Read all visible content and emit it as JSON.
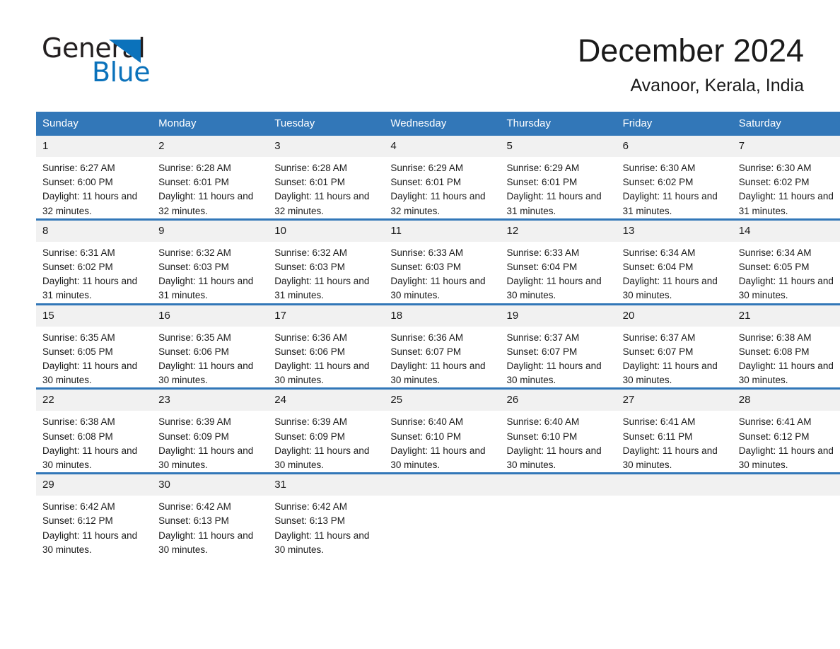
{
  "brand": {
    "name_part1": "General",
    "name_part2": "Blue",
    "accent_color": "#0b72bb",
    "header_color": "#3277b8"
  },
  "header": {
    "title": "December 2024",
    "location": "Avanoor, Kerala, India"
  },
  "calendar": {
    "weekday_headers": [
      "Sunday",
      "Monday",
      "Tuesday",
      "Wednesday",
      "Thursday",
      "Friday",
      "Saturday"
    ],
    "weeks": [
      [
        {
          "day": "1",
          "sunrise": "Sunrise: 6:27 AM",
          "sunset": "Sunset: 6:00 PM",
          "daylight": "Daylight: 11 hours and 32 minutes."
        },
        {
          "day": "2",
          "sunrise": "Sunrise: 6:28 AM",
          "sunset": "Sunset: 6:01 PM",
          "daylight": "Daylight: 11 hours and 32 minutes."
        },
        {
          "day": "3",
          "sunrise": "Sunrise: 6:28 AM",
          "sunset": "Sunset: 6:01 PM",
          "daylight": "Daylight: 11 hours and 32 minutes."
        },
        {
          "day": "4",
          "sunrise": "Sunrise: 6:29 AM",
          "sunset": "Sunset: 6:01 PM",
          "daylight": "Daylight: 11 hours and 32 minutes."
        },
        {
          "day": "5",
          "sunrise": "Sunrise: 6:29 AM",
          "sunset": "Sunset: 6:01 PM",
          "daylight": "Daylight: 11 hours and 31 minutes."
        },
        {
          "day": "6",
          "sunrise": "Sunrise: 6:30 AM",
          "sunset": "Sunset: 6:02 PM",
          "daylight": "Daylight: 11 hours and 31 minutes."
        },
        {
          "day": "7",
          "sunrise": "Sunrise: 6:30 AM",
          "sunset": "Sunset: 6:02 PM",
          "daylight": "Daylight: 11 hours and 31 minutes."
        }
      ],
      [
        {
          "day": "8",
          "sunrise": "Sunrise: 6:31 AM",
          "sunset": "Sunset: 6:02 PM",
          "daylight": "Daylight: 11 hours and 31 minutes."
        },
        {
          "day": "9",
          "sunrise": "Sunrise: 6:32 AM",
          "sunset": "Sunset: 6:03 PM",
          "daylight": "Daylight: 11 hours and 31 minutes."
        },
        {
          "day": "10",
          "sunrise": "Sunrise: 6:32 AM",
          "sunset": "Sunset: 6:03 PM",
          "daylight": "Daylight: 11 hours and 31 minutes."
        },
        {
          "day": "11",
          "sunrise": "Sunrise: 6:33 AM",
          "sunset": "Sunset: 6:03 PM",
          "daylight": "Daylight: 11 hours and 30 minutes."
        },
        {
          "day": "12",
          "sunrise": "Sunrise: 6:33 AM",
          "sunset": "Sunset: 6:04 PM",
          "daylight": "Daylight: 11 hours and 30 minutes."
        },
        {
          "day": "13",
          "sunrise": "Sunrise: 6:34 AM",
          "sunset": "Sunset: 6:04 PM",
          "daylight": "Daylight: 11 hours and 30 minutes."
        },
        {
          "day": "14",
          "sunrise": "Sunrise: 6:34 AM",
          "sunset": "Sunset: 6:05 PM",
          "daylight": "Daylight: 11 hours and 30 minutes."
        }
      ],
      [
        {
          "day": "15",
          "sunrise": "Sunrise: 6:35 AM",
          "sunset": "Sunset: 6:05 PM",
          "daylight": "Daylight: 11 hours and 30 minutes."
        },
        {
          "day": "16",
          "sunrise": "Sunrise: 6:35 AM",
          "sunset": "Sunset: 6:06 PM",
          "daylight": "Daylight: 11 hours and 30 minutes."
        },
        {
          "day": "17",
          "sunrise": "Sunrise: 6:36 AM",
          "sunset": "Sunset: 6:06 PM",
          "daylight": "Daylight: 11 hours and 30 minutes."
        },
        {
          "day": "18",
          "sunrise": "Sunrise: 6:36 AM",
          "sunset": "Sunset: 6:07 PM",
          "daylight": "Daylight: 11 hours and 30 minutes."
        },
        {
          "day": "19",
          "sunrise": "Sunrise: 6:37 AM",
          "sunset": "Sunset: 6:07 PM",
          "daylight": "Daylight: 11 hours and 30 minutes."
        },
        {
          "day": "20",
          "sunrise": "Sunrise: 6:37 AM",
          "sunset": "Sunset: 6:07 PM",
          "daylight": "Daylight: 11 hours and 30 minutes."
        },
        {
          "day": "21",
          "sunrise": "Sunrise: 6:38 AM",
          "sunset": "Sunset: 6:08 PM",
          "daylight": "Daylight: 11 hours and 30 minutes."
        }
      ],
      [
        {
          "day": "22",
          "sunrise": "Sunrise: 6:38 AM",
          "sunset": "Sunset: 6:08 PM",
          "daylight": "Daylight: 11 hours and 30 minutes."
        },
        {
          "day": "23",
          "sunrise": "Sunrise: 6:39 AM",
          "sunset": "Sunset: 6:09 PM",
          "daylight": "Daylight: 11 hours and 30 minutes."
        },
        {
          "day": "24",
          "sunrise": "Sunrise: 6:39 AM",
          "sunset": "Sunset: 6:09 PM",
          "daylight": "Daylight: 11 hours and 30 minutes."
        },
        {
          "day": "25",
          "sunrise": "Sunrise: 6:40 AM",
          "sunset": "Sunset: 6:10 PM",
          "daylight": "Daylight: 11 hours and 30 minutes."
        },
        {
          "day": "26",
          "sunrise": "Sunrise: 6:40 AM",
          "sunset": "Sunset: 6:10 PM",
          "daylight": "Daylight: 11 hours and 30 minutes."
        },
        {
          "day": "27",
          "sunrise": "Sunrise: 6:41 AM",
          "sunset": "Sunset: 6:11 PM",
          "daylight": "Daylight: 11 hours and 30 minutes."
        },
        {
          "day": "28",
          "sunrise": "Sunrise: 6:41 AM",
          "sunset": "Sunset: 6:12 PM",
          "daylight": "Daylight: 11 hours and 30 minutes."
        }
      ],
      [
        {
          "day": "29",
          "sunrise": "Sunrise: 6:42 AM",
          "sunset": "Sunset: 6:12 PM",
          "daylight": "Daylight: 11 hours and 30 minutes."
        },
        {
          "day": "30",
          "sunrise": "Sunrise: 6:42 AM",
          "sunset": "Sunset: 6:13 PM",
          "daylight": "Daylight: 11 hours and 30 minutes."
        },
        {
          "day": "31",
          "sunrise": "Sunrise: 6:42 AM",
          "sunset": "Sunset: 6:13 PM",
          "daylight": "Daylight: 11 hours and 30 minutes."
        },
        {
          "day": "",
          "sunrise": "",
          "sunset": "",
          "daylight": ""
        },
        {
          "day": "",
          "sunrise": "",
          "sunset": "",
          "daylight": ""
        },
        {
          "day": "",
          "sunrise": "",
          "sunset": "",
          "daylight": ""
        },
        {
          "day": "",
          "sunrise": "",
          "sunset": "",
          "daylight": ""
        }
      ]
    ]
  }
}
